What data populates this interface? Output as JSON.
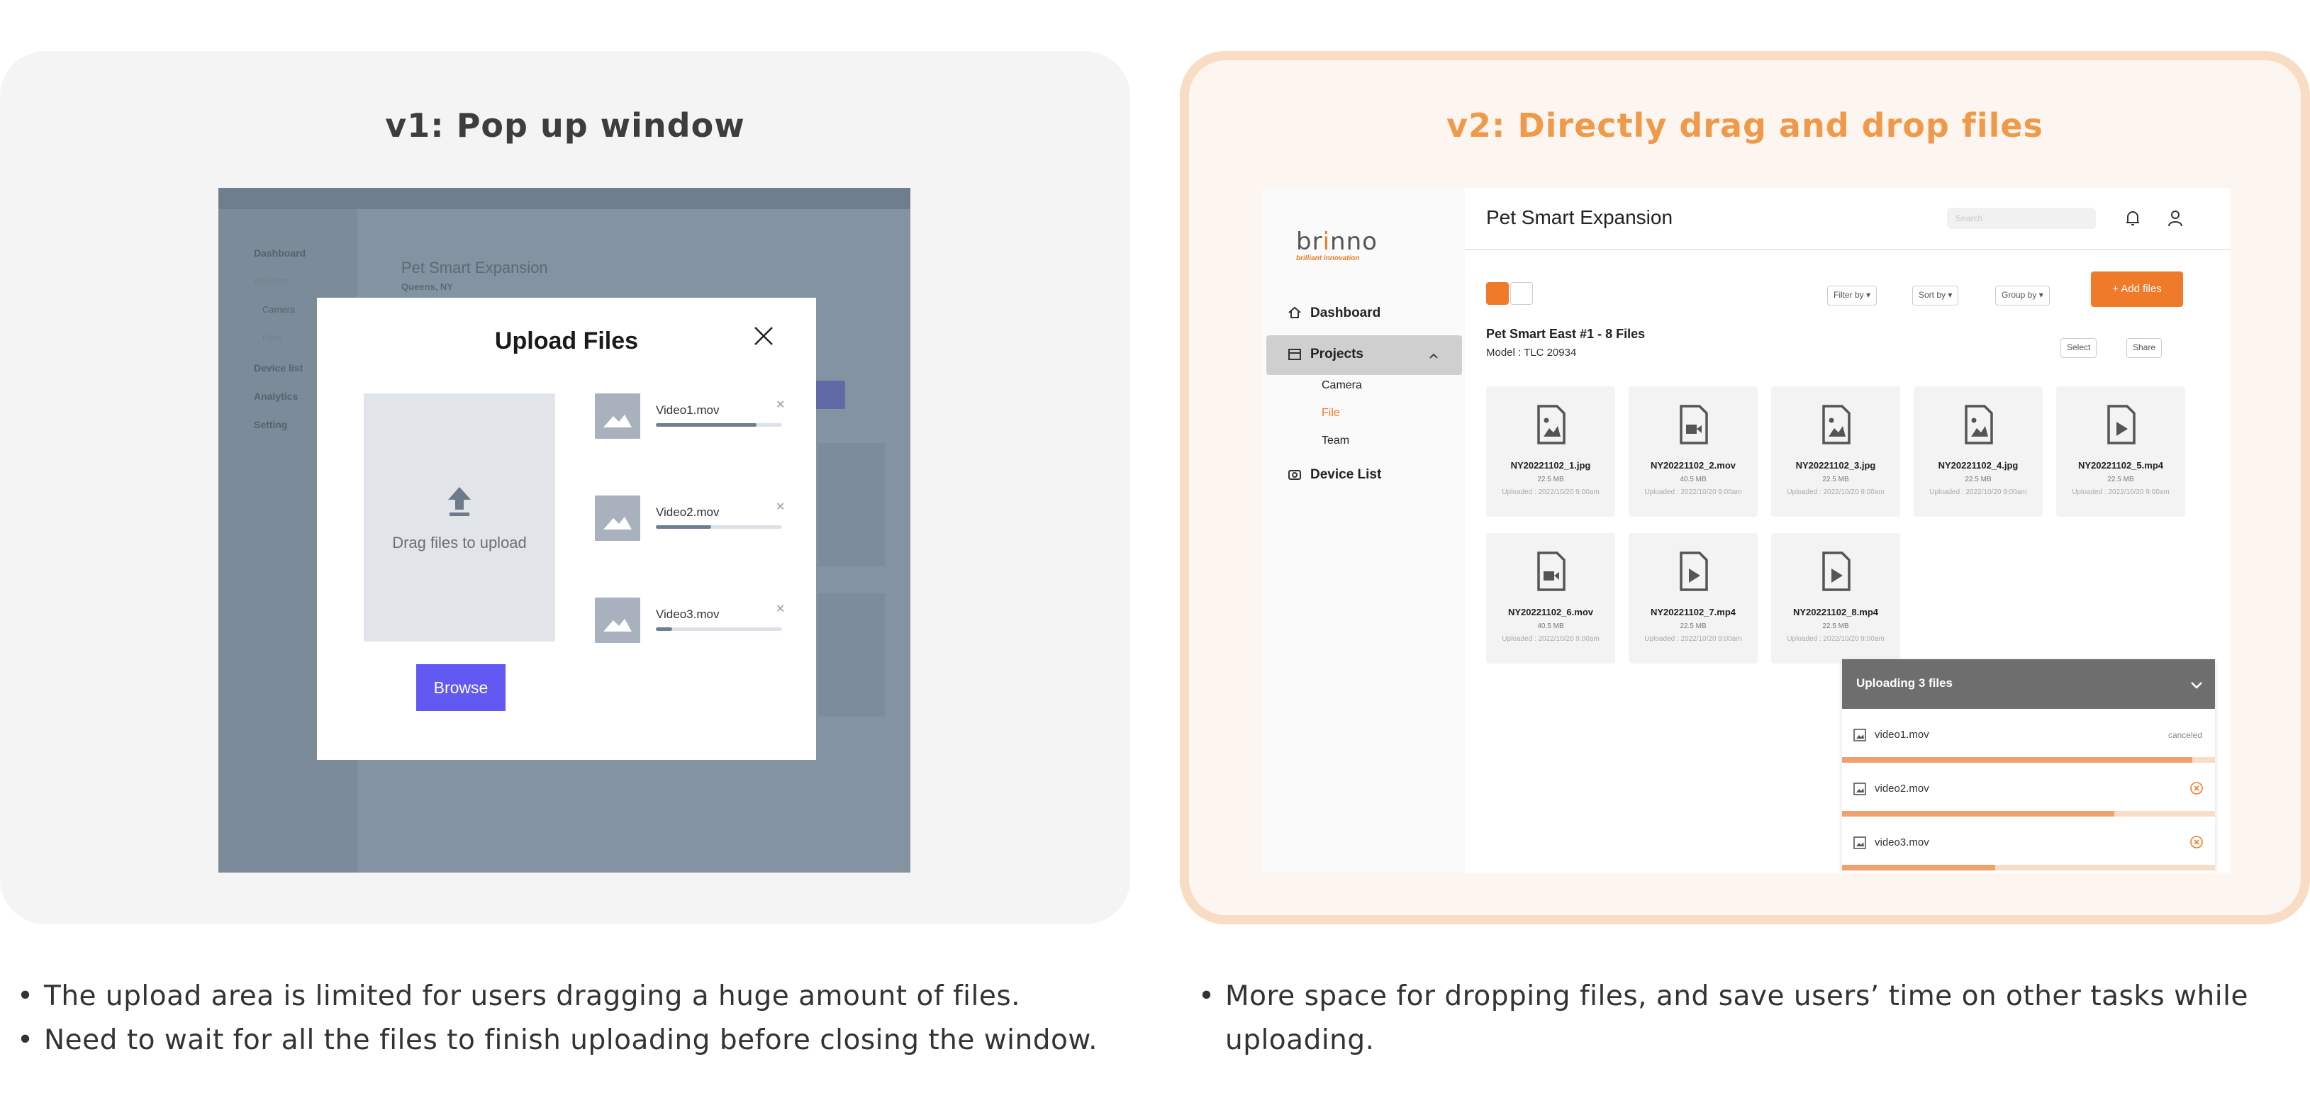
{
  "v1": {
    "title": "v1: Pop up window",
    "background_app": {
      "nav": [
        "Dashboard",
        "Projects",
        "Camera",
        "Files",
        "Device list",
        "Analytics",
        "Setting"
      ],
      "project_title": "Pet Smart Expansion",
      "project_location": "Queens, NY"
    },
    "modal": {
      "title": "Upload Files",
      "dropzone_label": "Drag files to upload",
      "browse_label": "Browse",
      "files": [
        {
          "name": "Video1.mov",
          "progress": 0.8
        },
        {
          "name": "Video2.mov",
          "progress": 0.44
        },
        {
          "name": "Video3.mov",
          "progress": 0.13
        }
      ]
    },
    "bullets": [
      "The upload area is limited for users dragging a huge amount of files.",
      "Need to wait for all the files to finish uploading before closing the window."
    ]
  },
  "v2": {
    "title": "v2: Directly drag and drop files",
    "logo": {
      "text_a": "br",
      "text_dot": "i",
      "text_b": "nno",
      "tagline": "brilliant innovation"
    },
    "sidebar": {
      "dashboard": "Dashboard",
      "projects": "Projects",
      "camera": "Camera",
      "file": "File",
      "team": "Team",
      "device_list": "Device List"
    },
    "header": {
      "title": "Pet Smart Expansion",
      "search_placeholder": "Search"
    },
    "toolbar": {
      "filter": "Filter by",
      "sort": "Sort by",
      "group": "Group by",
      "add_files": "+ Add files",
      "select": "Select",
      "share": "Share"
    },
    "group": {
      "title": "Pet Smart East #1 - 8 Files",
      "model": "Model : TLC 20934"
    },
    "files": [
      {
        "name": "NY20221102_1.jpg",
        "size": "22.5 MB",
        "uploaded": "Uploaded : 2022/10/20 9:00am",
        "kind": "image"
      },
      {
        "name": "NY20221102_2.mov",
        "size": "40.5 MB",
        "uploaded": "Uploaded : 2022/10/20 9:00am",
        "kind": "video"
      },
      {
        "name": "NY20221102_3.jpg",
        "size": "22.5 MB",
        "uploaded": "Uploaded : 2022/10/20 9:00am",
        "kind": "image"
      },
      {
        "name": "NY20221102_4.jpg",
        "size": "22.5 MB",
        "uploaded": "Uploaded : 2022/10/20 9:00am",
        "kind": "image"
      },
      {
        "name": "NY20221102_5.mp4",
        "size": "22.5 MB",
        "uploaded": "Uploaded : 2022/10/20 9:00am",
        "kind": "play"
      },
      {
        "name": "NY20221102_6.mov",
        "size": "40.5 MB",
        "uploaded": "Uploaded : 2022/10/20 9:00am",
        "kind": "video"
      },
      {
        "name": "NY20221102_7.mp4",
        "size": "22.5 MB",
        "uploaded": "Uploaded : 2022/10/20 9:00am",
        "kind": "play"
      },
      {
        "name": "NY20221102_8.mp4",
        "size": "22.5 MB",
        "uploaded": "Uploaded : 2022/10/20 9:00am",
        "kind": "play"
      }
    ],
    "upload_panel": {
      "title": "Uploading 3 files",
      "items": [
        {
          "name": "video1.mov",
          "status": "canceled",
          "progress": 0.94
        },
        {
          "name": "video2.mov",
          "status": "",
          "progress": 0.73
        },
        {
          "name": "video3.mov",
          "status": "",
          "progress": 0.41
        }
      ]
    },
    "bullets": [
      "More space for dropping files, and save users’ time on other tasks while uploading."
    ]
  },
  "colors": {
    "accent_orange": "#ef7a2a",
    "browse_purple": "#6258f2"
  }
}
